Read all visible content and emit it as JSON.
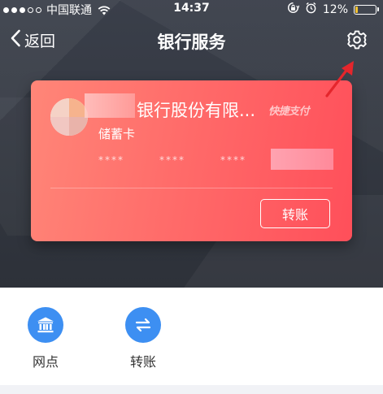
{
  "status_bar": {
    "carrier": "中国联通",
    "time": "14:37",
    "battery": "12%",
    "battery_level": 0.12
  },
  "nav": {
    "back_label": "返回",
    "title": "银行服务"
  },
  "card": {
    "bank_name": "银行股份有限...",
    "quick_pay": "快捷支付",
    "card_type": "储蓄卡",
    "number_groups": [
      "****",
      "****",
      "****"
    ],
    "transfer_label": "转账"
  },
  "services": [
    {
      "label": "网点",
      "icon": "bank-icon"
    },
    {
      "label": "转账",
      "icon": "transfer-icon"
    }
  ],
  "colors": {
    "card_start": "#ff8678",
    "card_end": "#ff4f5a",
    "service_icon": "#3d8ff2",
    "annotation_arrow": "#e5262c",
    "battery_fill": "#f4c230"
  }
}
